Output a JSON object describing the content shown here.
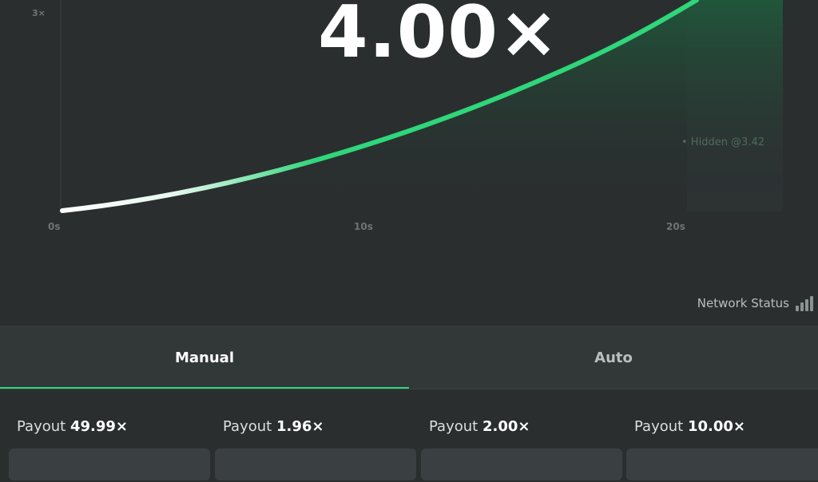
{
  "chart": {
    "y_tick": "3×",
    "x_ticks": [
      "0s",
      "10s",
      "20s"
    ],
    "current_multiplier": "4.00×",
    "hidden_bet": "• Hidden @3.42",
    "curve_color": "#2fd67a"
  },
  "network": {
    "label": "Network Status"
  },
  "tabs": [
    {
      "label": "Manual",
      "active": true
    },
    {
      "label": "Auto",
      "active": false
    }
  ],
  "payouts": [
    {
      "label": "Payout",
      "value": "49.99×"
    },
    {
      "label": "Payout",
      "value": "1.96×"
    },
    {
      "label": "Payout",
      "value": "2.00×"
    },
    {
      "label": "Payout",
      "value": "10.00×"
    }
  ]
}
